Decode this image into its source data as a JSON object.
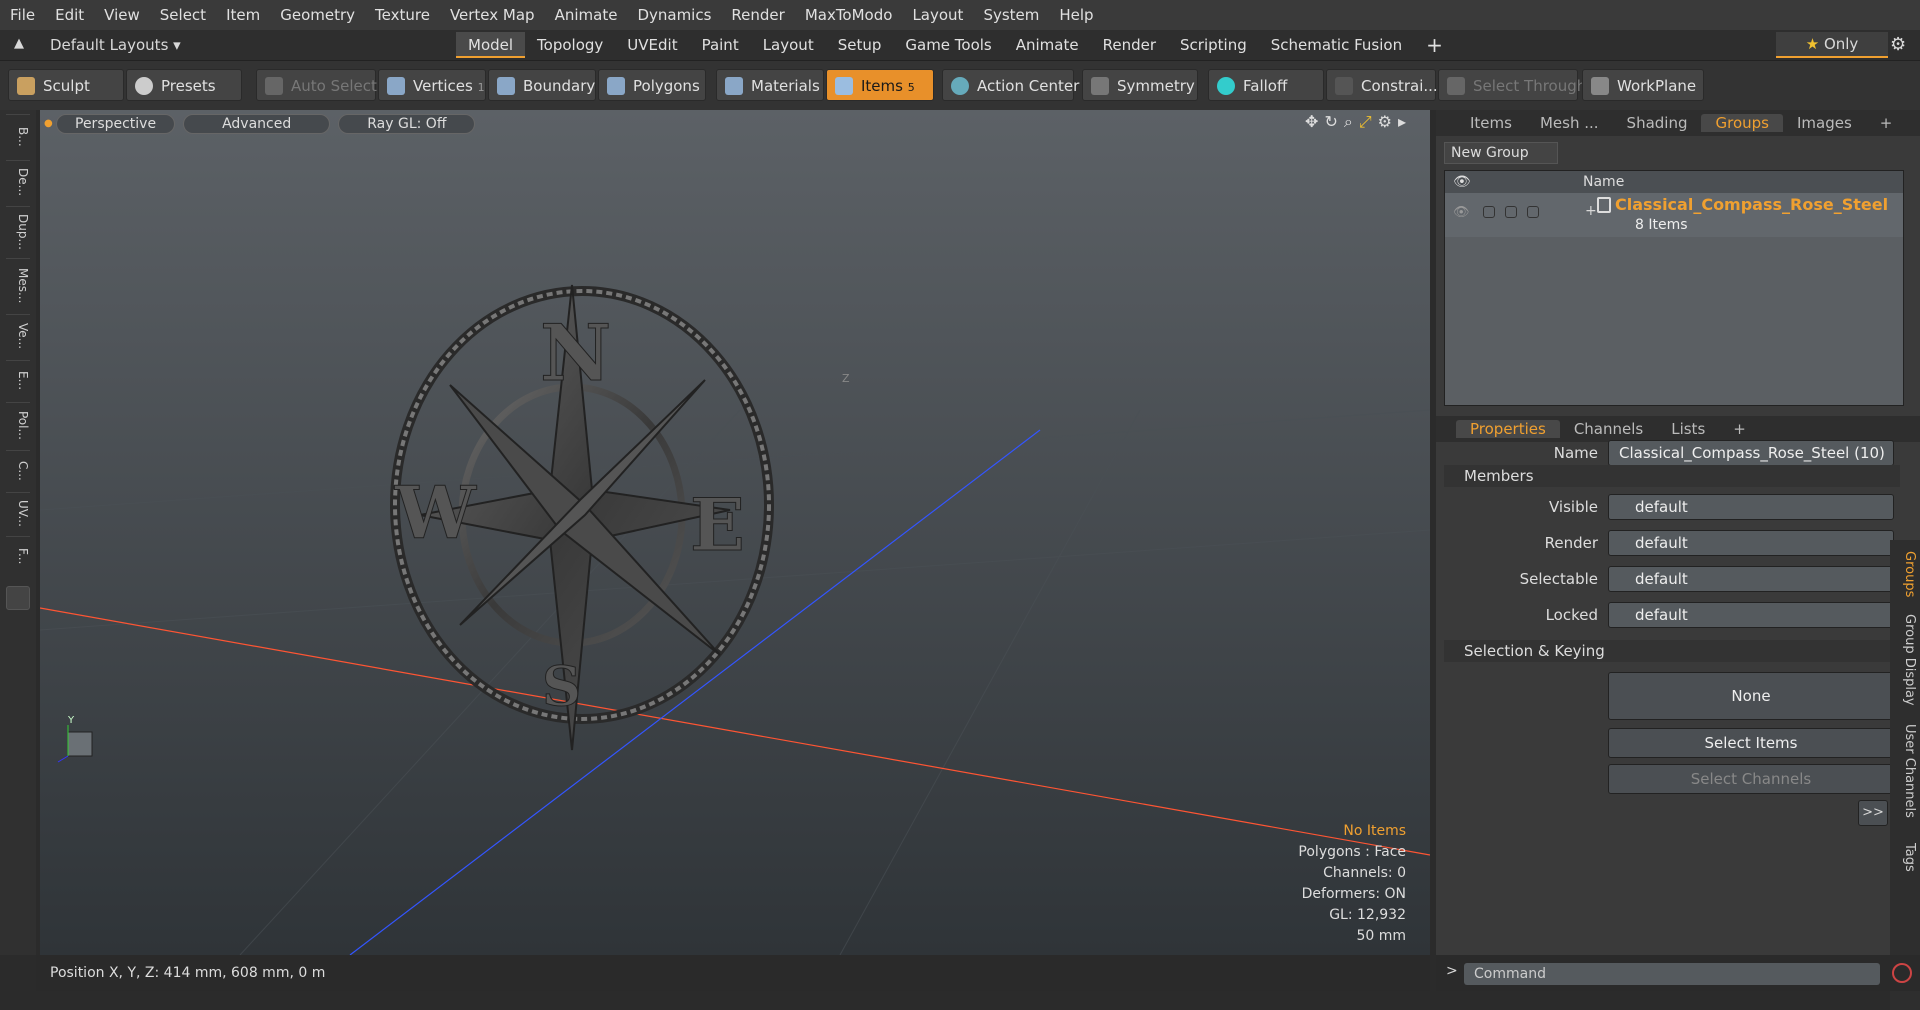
{
  "menu": [
    "File",
    "Edit",
    "View",
    "Select",
    "Item",
    "Geometry",
    "Texture",
    "Vertex Map",
    "Animate",
    "Dynamics",
    "Render",
    "MaxToModo",
    "Layout",
    "System",
    "Help"
  ],
  "layout_dropdown": "Default Layouts",
  "layout_tabs": [
    "Model",
    "Topology",
    "UVEdit",
    "Paint",
    "Layout",
    "Setup",
    "Game Tools",
    "Animate",
    "Render",
    "Scripting",
    "Schematic Fusion"
  ],
  "only_label": "Only",
  "toolbar": {
    "sculpt": "Sculpt",
    "presets": "Presets",
    "auto_select": "Auto Select",
    "vertices": "Vertices",
    "vertices_count": "1",
    "boundary": "Boundary",
    "polygons": "Polygons",
    "materials": "Materials",
    "items": "Items",
    "items_count": "5",
    "action_center": "Action Center",
    "symmetry": "Symmetry",
    "falloff": "Falloff",
    "constrain": "Constrai...",
    "select_through": "Select Through",
    "workplane": "WorkPlane"
  },
  "left_tools": [
    "B...",
    "De...",
    "Dup...",
    "Mes...",
    "Ve...",
    "E...",
    "Pol...",
    "C...",
    "UV...",
    "F..."
  ],
  "viewport": {
    "view": "Perspective",
    "style": "Advanced",
    "raygl": "Ray GL: Off",
    "stats": {
      "selection": "No Items",
      "polygons": "Polygons : Face",
      "channels": "Channels: 0",
      "deformers": "Deformers: ON",
      "gl": "GL: 12,932",
      "size": "50 mm"
    },
    "compass_letters": {
      "n": "N",
      "w": "W",
      "e": "E",
      "s": "S"
    },
    "axis_labels": {
      "y": "Y",
      "z": "Z"
    }
  },
  "status": {
    "position": "Position X, Y, Z:   414 mm, 608 mm, 0 m"
  },
  "top_tabs": [
    "Items",
    "Mesh ...",
    "Shading",
    "Groups",
    "Images"
  ],
  "groups": {
    "new_group": "New Group",
    "col_name": "Name",
    "name": "Classical_Compass_Rose_Steel",
    "count": "8 Items"
  },
  "prop_tabs": [
    "Properties",
    "Channels",
    "Lists"
  ],
  "properties": {
    "name_label": "Name",
    "name_value": "Classical_Compass_Rose_Steel (10)",
    "members": "Members",
    "visible_label": "Visible",
    "render_label": "Render",
    "selectable_label": "Selectable",
    "locked_label": "Locked",
    "default": "default",
    "sel_keying": "Selection & Keying",
    "none": "None",
    "select_items": "Select Items",
    "select_channels": "Select Channels",
    "more": ">>"
  },
  "vtabs": [
    "Groups",
    "Group Display",
    "User Channels",
    "Tags"
  ],
  "command_placeholder": "Command",
  "colors": {
    "accent": "#f0a030",
    "x_axis": "#ff5533",
    "z_axis": "#3355ff"
  }
}
